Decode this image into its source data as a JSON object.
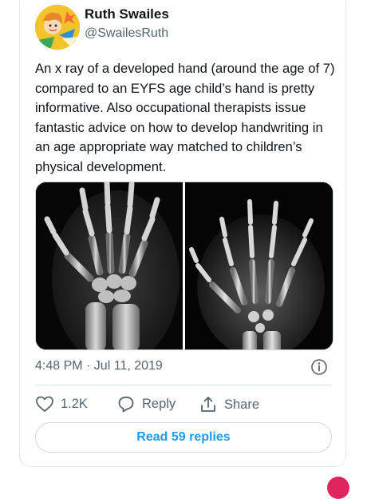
{
  "author": {
    "display_name": "Ruth Swailes",
    "handle": "@SwailesRuth"
  },
  "tweet": {
    "text": "An x ray of a developed hand (around the age of 7) compared to an EYFS age child’s hand is pretty informative. Also occupational therapists issue fantastic advice on how to develop handwriting in an age appropriate way matched to children’s physical development.",
    "timestamp": "4:48 PM · Jul 11, 2019"
  },
  "actions": {
    "like_count": "1.2K",
    "reply_label": "Reply",
    "share_label": "Share"
  },
  "replies": {
    "label": "Read 59 replies"
  },
  "colors": {
    "accent": "#1d9bf0",
    "secondary_text": "#536471",
    "border": "#cfd9de"
  },
  "icons": [
    "heart-icon",
    "reply-icon",
    "share-icon",
    "info-icon"
  ]
}
